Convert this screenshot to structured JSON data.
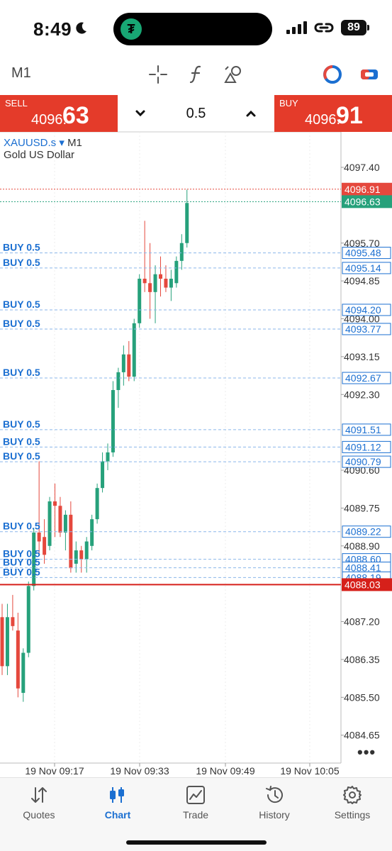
{
  "status_bar": {
    "time": "8:49",
    "battery": "89"
  },
  "toolbar": {
    "timeframe": "M1"
  },
  "trade": {
    "sell_label": "SELL",
    "sell_price_small": "4096.",
    "sell_price_big": "63",
    "buy_label": "BUY",
    "buy_price_small": "4096.",
    "buy_price_big": "91",
    "volume": "0.5"
  },
  "chart": {
    "symbol": "XAUUSD.s",
    "symbol_arrow": "▾",
    "timeframe": "M1",
    "description": "Gold US Dollar",
    "price_scale": [
      "4097.40",
      "4095.70",
      "4094.85",
      "4094.00",
      "4093.15",
      "4092.30",
      "4090.60",
      "4089.75",
      "4088.90",
      "4087.20",
      "4086.35",
      "4085.50",
      "4084.65"
    ],
    "time_labels": [
      "19 Nov 09:17",
      "19 Nov 09:33",
      "19 Nov 09:49",
      "19 Nov 10:05"
    ],
    "ask_price": 4096.91,
    "bid_price": 4096.63,
    "ask_label": "4096.91",
    "bid_label": "4096.63",
    "last_price": 4088.03,
    "last_label": "4088.03",
    "order_label": "BUY 0.5",
    "orders": [
      {
        "price": 4095.48,
        "label": "4095.48"
      },
      {
        "price": 4095.14,
        "label": "4095.14"
      },
      {
        "price": 4094.2,
        "label": "4094.20"
      },
      {
        "price": 4093.77,
        "label": "4093.77"
      },
      {
        "price": 4092.67,
        "label": "4092.67"
      },
      {
        "price": 4091.51,
        "label": "4091.51"
      },
      {
        "price": 4091.12,
        "label": "4091.12"
      },
      {
        "price": 4090.79,
        "label": "4090.79"
      },
      {
        "price": 4089.22,
        "label": "4089.22"
      },
      {
        "price": 4088.6,
        "label": "4088.60"
      },
      {
        "price": 4088.41,
        "label": "4088.41"
      },
      {
        "price": 4088.19,
        "label": "4088.19"
      }
    ],
    "colors": {
      "up": "#26a17b",
      "down": "#e5483d",
      "ask": "#e5483d",
      "bid": "#26a17b",
      "order": "#1b6fd1",
      "last": "#d6201a"
    }
  },
  "chart_data": {
    "type": "candlestick",
    "x_ticks": [
      "19 Nov 09:17",
      "19 Nov 09:33",
      "19 Nov 09:49",
      "19 Nov 10:05"
    ],
    "ylim": [
      4084.3,
      4097.6
    ],
    "candles": [
      {
        "o": 4087.3,
        "h": 4087.6,
        "l": 4086.0,
        "c": 4086.2
      },
      {
        "o": 4086.2,
        "h": 4087.6,
        "l": 4086.0,
        "c": 4087.3
      },
      {
        "o": 4087.3,
        "h": 4087.8,
        "l": 4087.0,
        "c": 4087.1
      },
      {
        "o": 4087.0,
        "h": 4087.4,
        "l": 4085.5,
        "c": 4085.7
      },
      {
        "o": 4085.6,
        "h": 4086.6,
        "l": 4085.4,
        "c": 4086.5
      },
      {
        "o": 4086.5,
        "h": 4088.1,
        "l": 4086.4,
        "c": 4088.0
      },
      {
        "o": 4088.0,
        "h": 4089.3,
        "l": 4087.9,
        "c": 4089.2
      },
      {
        "o": 4089.2,
        "h": 4090.8,
        "l": 4088.7,
        "c": 4089.0
      },
      {
        "o": 4089.1,
        "h": 4089.5,
        "l": 4088.5,
        "c": 4088.7
      },
      {
        "o": 4088.9,
        "h": 4090.0,
        "l": 4088.8,
        "c": 4089.9
      },
      {
        "o": 4089.9,
        "h": 4090.3,
        "l": 4089.1,
        "c": 4089.8
      },
      {
        "o": 4089.8,
        "h": 4090.0,
        "l": 4089.1,
        "c": 4089.2
      },
      {
        "o": 4089.2,
        "h": 4089.7,
        "l": 4088.8,
        "c": 4089.6
      },
      {
        "o": 4089.6,
        "h": 4089.9,
        "l": 4088.3,
        "c": 4088.4
      },
      {
        "o": 4088.5,
        "h": 4089.0,
        "l": 4088.3,
        "c": 4088.8
      },
      {
        "o": 4088.8,
        "h": 4088.9,
        "l": 4088.3,
        "c": 4088.6
      },
      {
        "o": 4088.6,
        "h": 4089.1,
        "l": 4088.3,
        "c": 4089.0
      },
      {
        "o": 4088.9,
        "h": 4089.6,
        "l": 4088.8,
        "c": 4089.5
      },
      {
        "o": 4089.5,
        "h": 4090.3,
        "l": 4089.4,
        "c": 4090.2
      },
      {
        "o": 4090.2,
        "h": 4091.0,
        "l": 4090.1,
        "c": 4090.8
      },
      {
        "o": 4090.8,
        "h": 4091.2,
        "l": 4090.6,
        "c": 4091.0
      },
      {
        "o": 4091.0,
        "h": 4092.6,
        "l": 4090.9,
        "c": 4092.4
      },
      {
        "o": 4092.4,
        "h": 4092.9,
        "l": 4092.0,
        "c": 4092.8
      },
      {
        "o": 4092.8,
        "h": 4093.4,
        "l": 4092.5,
        "c": 4093.2
      },
      {
        "o": 4093.2,
        "h": 4093.5,
        "l": 4092.6,
        "c": 4092.7
      },
      {
        "o": 4092.7,
        "h": 4094.0,
        "l": 4092.6,
        "c": 4093.9
      },
      {
        "o": 4093.9,
        "h": 4095.0,
        "l": 4093.8,
        "c": 4094.9
      },
      {
        "o": 4094.9,
        "h": 4096.2,
        "l": 4094.6,
        "c": 4094.8
      },
      {
        "o": 4094.8,
        "h": 4095.7,
        "l": 4094.0,
        "c": 4094.6
      },
      {
        "o": 4094.6,
        "h": 4095.2,
        "l": 4093.9,
        "c": 4095.0
      },
      {
        "o": 4095.0,
        "h": 4095.4,
        "l": 4094.5,
        "c": 4094.9
      },
      {
        "o": 4094.9,
        "h": 4095.2,
        "l": 4094.6,
        "c": 4094.7
      },
      {
        "o": 4094.7,
        "h": 4095.1,
        "l": 4094.4,
        "c": 4094.9
      },
      {
        "o": 4094.8,
        "h": 4095.4,
        "l": 4094.7,
        "c": 4095.3
      },
      {
        "o": 4095.3,
        "h": 4095.9,
        "l": 4095.1,
        "c": 4095.7
      },
      {
        "o": 4095.7,
        "h": 4096.9,
        "l": 4095.6,
        "c": 4096.6
      }
    ]
  },
  "nav": {
    "items": [
      {
        "label": "Quotes"
      },
      {
        "label": "Chart"
      },
      {
        "label": "Trade"
      },
      {
        "label": "History"
      },
      {
        "label": "Settings"
      }
    ]
  }
}
